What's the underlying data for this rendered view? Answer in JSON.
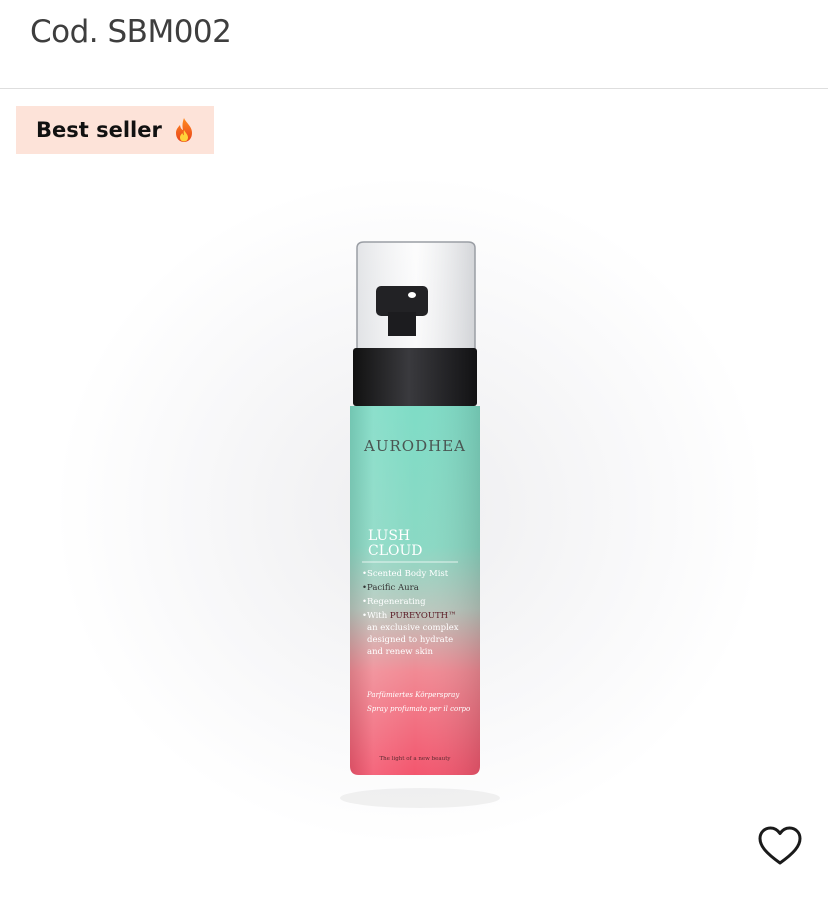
{
  "header": {
    "code": "Cod. SBM002"
  },
  "badge": {
    "label": "Best seller",
    "icon": "fire-icon"
  },
  "product": {
    "image": "scented-body-mist-bottle",
    "brand": "AURODHEA",
    "name_line1": "LUSH",
    "name_line2": "CLOUD",
    "bullets": [
      "Scented Body Mist",
      "Pacific Aura",
      "Regenerating"
    ],
    "bullet4_prefix": "With ",
    "bullet4_brand": "PUREYOUTH™",
    "description_lines": [
      "an exclusive complex",
      "designed to hydrate",
      "and renew skin"
    ],
    "translations": [
      "Parfümiertes Körperspray",
      "Spray profumato per il corpo"
    ],
    "tagline": "The light of a new beauty"
  },
  "actions": {
    "favorite_icon": "heart-icon"
  },
  "colors": {
    "badge_bg": "#fde3d9",
    "bottle_top": "#7fdcc6",
    "bottle_bottom": "#f3566e",
    "cap": "#1f1f22"
  }
}
